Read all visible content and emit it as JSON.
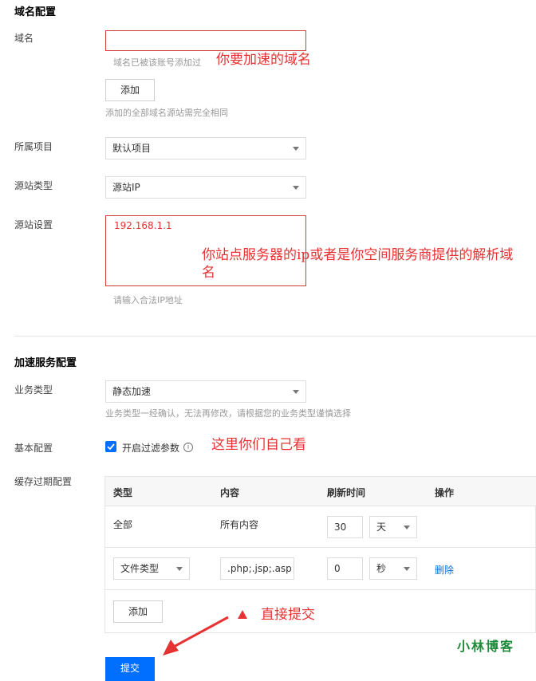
{
  "domain_section": {
    "title": "域名配置",
    "domain_label": "域名",
    "domain_value": "",
    "domain_hint": "域名已被该账号添加过",
    "domain_annotation": "你要加速的域名",
    "add_button": "添加",
    "add_hint": "添加的全部域名源站需完全相同",
    "project_label": "所属项目",
    "project_value": "默认项目",
    "origin_type_label": "源站类型",
    "origin_type_value": "源站IP",
    "origin_setting_label": "源站设置",
    "origin_setting_value": "192.168.1.1",
    "origin_annotation_line1": "你站点服务器的ip或者是你空间服务商提供的解析域",
    "origin_annotation_line2": "名",
    "origin_hint": "请输入合法IP地址"
  },
  "accel_section": {
    "title": "加速服务配置",
    "business_label": "业务类型",
    "business_value": "静态加速",
    "business_hint": "业务类型一经确认，无法再修改，请根据您的业务类型谨慎选择",
    "basic_label": "基本配置",
    "filter_checkbox_label": "开启过滤参数",
    "filter_checked": true,
    "basic_annotation": "这里你们自己看",
    "cache_label": "缓存过期配置",
    "cache_table": {
      "headers": [
        "类型",
        "内容",
        "刷新时间",
        "操作"
      ],
      "row1": {
        "type": "全部",
        "content": "所有内容",
        "time": "30",
        "unit": "天"
      },
      "row2": {
        "type": "文件类型",
        "content": ".php;.jsp;.asp",
        "time": "0",
        "unit": "秒",
        "action": "删除"
      },
      "add_button": "添加"
    },
    "submit_annotation": "直接提交",
    "submit_button": "提交"
  },
  "watermark": "小林博客",
  "colors": {
    "annotation_red": "#e63232",
    "link_blue": "#0a6ed1",
    "submit_blue": "#006eff",
    "checkbox_blue": "#006eff",
    "watermark_green": "#1f8a3a"
  }
}
